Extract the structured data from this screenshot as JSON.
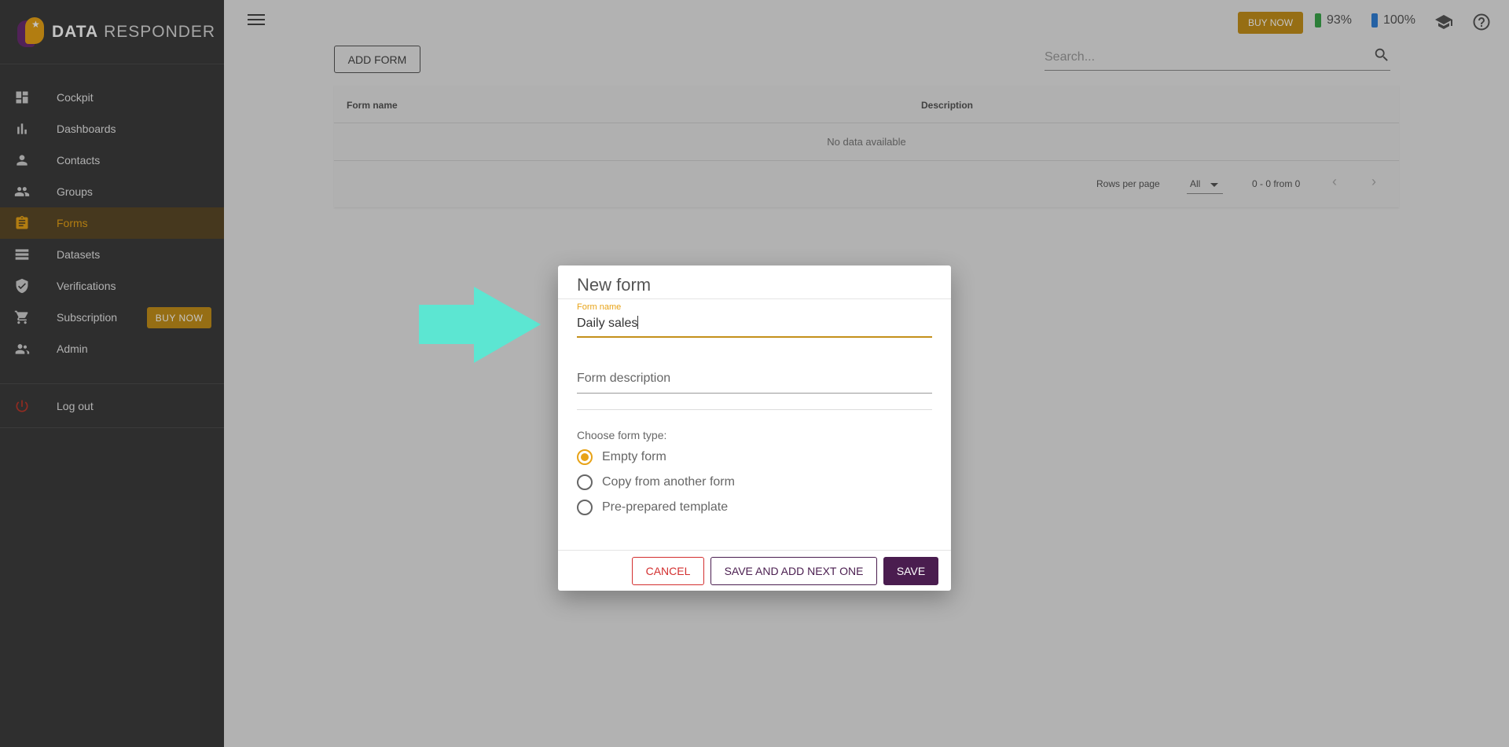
{
  "brand": {
    "logo_bold": "DATA",
    "logo_light": "RESPONDER"
  },
  "sidebar": {
    "items": [
      {
        "label": "Cockpit",
        "icon": "dashboard-icon"
      },
      {
        "label": "Dashboards",
        "icon": "bar-chart-icon"
      },
      {
        "label": "Contacts",
        "icon": "person-icon"
      },
      {
        "label": "Groups",
        "icon": "people-icon"
      },
      {
        "label": "Forms",
        "icon": "clipboard-icon",
        "active": true
      },
      {
        "label": "Datasets",
        "icon": "list-icon"
      },
      {
        "label": "Verifications",
        "icon": "shield-icon"
      },
      {
        "label": "Subscription",
        "icon": "cart-icon",
        "badge": "BUY NOW"
      },
      {
        "label": "Admin",
        "icon": "admin-icon"
      }
    ],
    "logout_label": "Log out"
  },
  "topbar": {
    "buy_now": "BUY NOW",
    "battery_green": "93%",
    "battery_blue": "100%"
  },
  "toolbar": {
    "add_form": "ADD FORM",
    "search_placeholder": "Search..."
  },
  "table": {
    "columns": [
      "Form name",
      "Description"
    ],
    "empty_text": "No data available",
    "rows_per_page_label": "Rows per page",
    "rows_per_page_value": "All",
    "range_text": "0 - 0 from 0"
  },
  "dialog": {
    "title": "New form",
    "form_name_label": "Form name",
    "form_name_value": "Daily sales",
    "form_description_placeholder": "Form description",
    "choose_type_label": "Choose form type:",
    "options": [
      {
        "label": "Empty form",
        "checked": true
      },
      {
        "label": "Copy from another form",
        "checked": false
      },
      {
        "label": "Pre-prepared template",
        "checked": false
      }
    ],
    "cancel": "CANCEL",
    "save_next": "SAVE AND ADD NEXT ONE",
    "save": "SAVE"
  },
  "colors": {
    "accent": "#e8a317",
    "primary": "#4a1d4f",
    "sidebar": "#3d3d3d",
    "arrow": "#5ce6d2",
    "danger": "#d32f2f"
  }
}
